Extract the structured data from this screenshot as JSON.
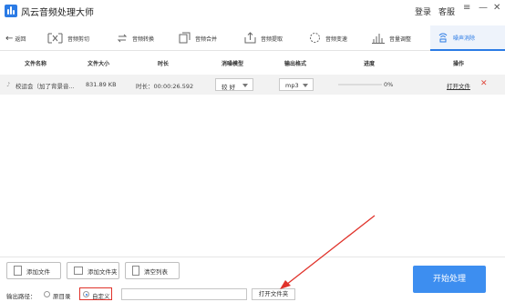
{
  "app": {
    "title": "风云音频处理大师"
  },
  "titlebar": {
    "login": "登录",
    "service": "客服",
    "menu_glyph": "≡",
    "minimize_glyph": "—",
    "close_glyph": "✕"
  },
  "toolbar": {
    "back_label": "返回",
    "items": [
      {
        "label": "音频剪切",
        "icon": "scissors-icon"
      },
      {
        "label": "音频转换",
        "icon": "convert-icon"
      },
      {
        "label": "音频合并",
        "icon": "merge-icon"
      },
      {
        "label": "音频提取",
        "icon": "extract-icon"
      },
      {
        "label": "音频变速",
        "icon": "speed-icon"
      },
      {
        "label": "音量调整",
        "icon": "volume-icon"
      },
      {
        "label": "噪声消除",
        "icon": "noise-icon",
        "active": true
      }
    ]
  },
  "table": {
    "headers": [
      "文件名称",
      "文件大小",
      "时长",
      "消噪模型",
      "输出格式",
      "进度",
      "操作"
    ],
    "rows": [
      {
        "name": "校运会（加了背景音...",
        "size": "831.89 KB",
        "duration": "时长：00:00:26.592",
        "model": "较 好",
        "format": "mp3",
        "progress": "0%",
        "progress_value": 0,
        "open_file": "打开文件",
        "delete_glyph": "✕"
      }
    ]
  },
  "bottom": {
    "add_file": "添加文件",
    "add_folder": "添加文件夹",
    "clear_list": "清空列表",
    "output_path_label": "输出路径：",
    "option_original": "原目录",
    "option_custom": "自定义",
    "selected_option": "自定义",
    "path_value": "",
    "open_folder": "打开文件夹",
    "start": "开始处理"
  },
  "colors": {
    "accent": "#2b7be5",
    "start_button": "#3d8ef0",
    "delete": "#e04a3f",
    "highlight_box": "#e0322a",
    "row_bg": "#f2f2f2"
  }
}
